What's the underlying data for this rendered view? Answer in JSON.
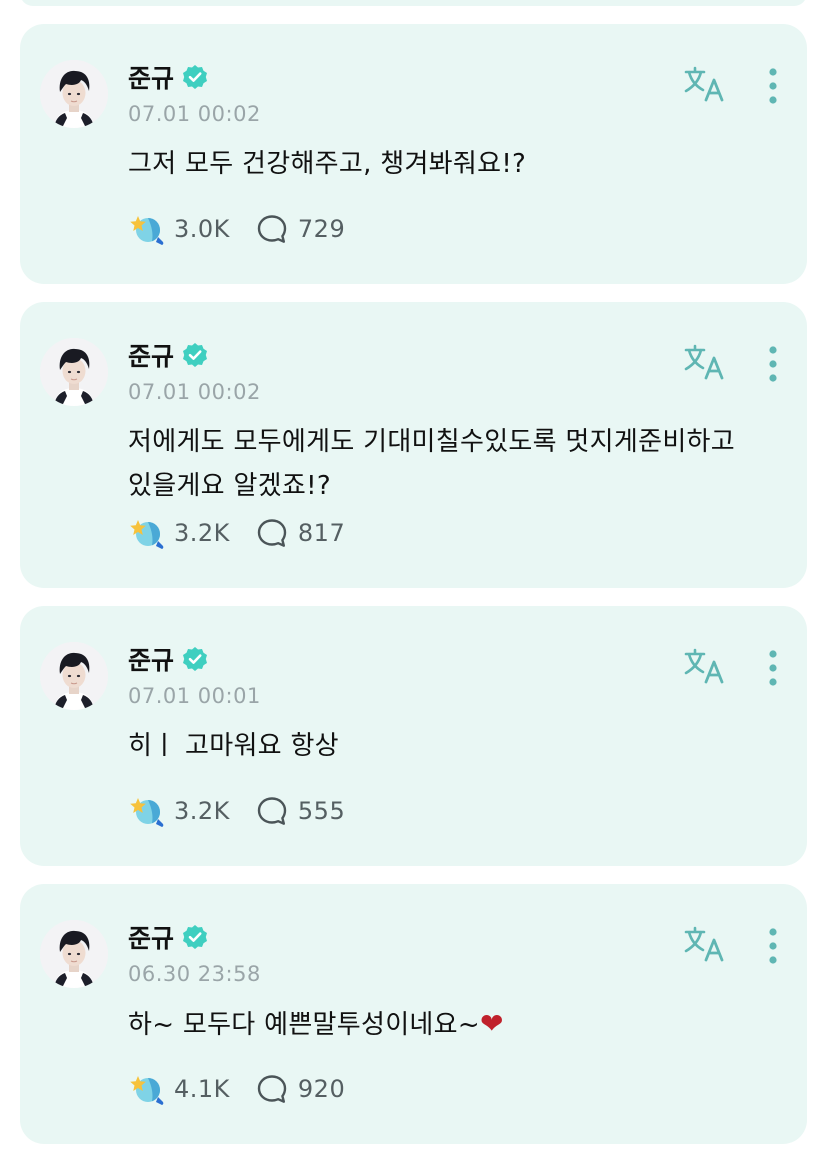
{
  "posts": [
    {
      "author": "준규",
      "time": "07.01 00:02",
      "text": "그저 모두 건강해주고, 챙겨봐줘요!?",
      "likes": "3.0K",
      "comments": "729"
    },
    {
      "author": "준규",
      "time": "07.01 00:02",
      "text": "저에게도 모두에게도 기대미칠수있도록 멋지게준비하고\n있을게요 알겠죠!?",
      "likes": "3.2K",
      "comments": "817"
    },
    {
      "author": "준규",
      "time": "07.01 00:01",
      "text": "히ㅣ 고마워요 항상",
      "likes": "3.2K",
      "comments": "555"
    },
    {
      "author": "준규",
      "time": "06.30 23:58",
      "text": "하~ 모두다 예쁜말투성이네요~",
      "text_emoji": "❤",
      "likes": "4.1K",
      "comments": "920"
    }
  ],
  "icons": {
    "verified": "verified-badge-icon",
    "translate": "translate-icon",
    "more": "more-vertical-icon",
    "like": "star-light-icon",
    "comment": "comment-bubble-icon"
  },
  "colors": {
    "card_background": "#e9f7f4",
    "verified": "#3fcfc0",
    "icon_teal": "#5fb6b3",
    "time_text": "#9aa5a8",
    "count_text": "#555f62",
    "heart": "#c0212b"
  }
}
